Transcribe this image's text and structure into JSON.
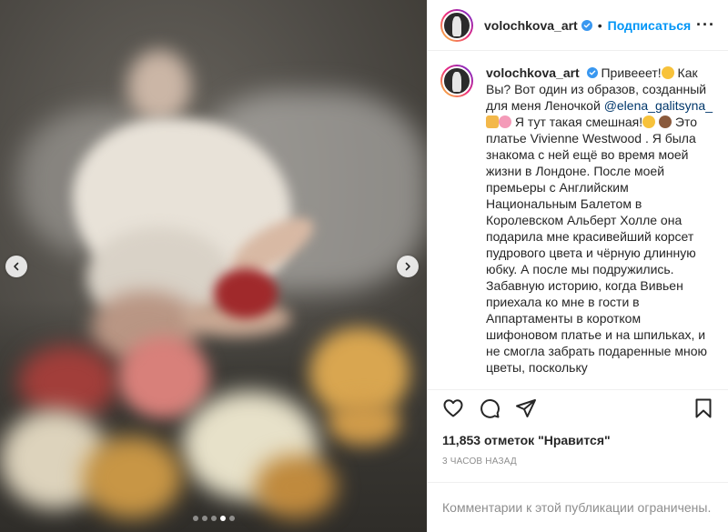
{
  "post": {
    "image_alt": "",
    "carousel": {
      "total": 5,
      "active_index": 3
    }
  },
  "header": {
    "username": "volochkova_art",
    "separator": "•",
    "follow_label": "Подписаться",
    "more_label": "···"
  },
  "caption": {
    "username": "volochkova_art",
    "part1": " Привееет!",
    "part2": " Как Вы? Вот один из образов, созданный для меня Леночкой ",
    "mention": "@elena_galitsyna_",
    "part3": " Я тут такая смешная!",
    "part4": " Это платье Vivienne Westwood . Я была знакома с ней ещё во время моей жизни в Лондоне. После моей премьеры с Английским Национальным Балетом в Королевском Альберт Холле она подарила мне красивейший корсет пудрового цвета и чёрную длинную юбку. А после мы подружились. Забавную историю, когда Вивьен приехала ко мне в гости в Аппартаменты в коротком шифоновом платье и на шпильках, и не смогла забрать подаренные мною цветы, поскольку"
  },
  "actions": {
    "like_icon": "heart-icon",
    "comment_icon": "comment-icon",
    "share_icon": "share-icon",
    "save_icon": "bookmark-icon"
  },
  "likes_text": "11,853 отметок \"Нравится\"",
  "time_text": "3 ЧАСОВ НАЗАД",
  "comments_disabled_text": "Комментарии к этой публикации ограничены.",
  "colors": {
    "accent": "#0095f6",
    "text": "#262626",
    "muted": "#8e8e8e",
    "border": "#efefef",
    "mention": "#00376b"
  }
}
